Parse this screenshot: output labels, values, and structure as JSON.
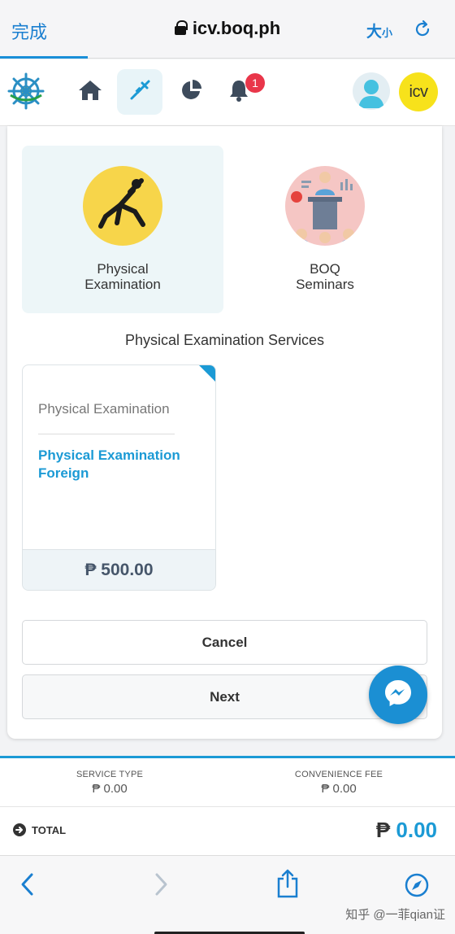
{
  "browser": {
    "done_label": "完成",
    "url": "icv.boq.ph",
    "text_size_big": "大",
    "text_size_small": "小"
  },
  "header": {
    "notification_count": "1",
    "brand_text": "icv"
  },
  "services": [
    {
      "label_line1": "Physical",
      "label_line2": "Examination",
      "selected": true
    },
    {
      "label_line1": "BOQ",
      "label_line2": "Seminars",
      "selected": false
    }
  ],
  "section_title": "Physical Examination Services",
  "package": {
    "name": "Physical Examination",
    "option_line1": "Physical Examination",
    "option_line2": "Foreign",
    "price": "₱ 500.00"
  },
  "buttons": {
    "cancel": "Cancel",
    "next": "Next"
  },
  "summary": {
    "service_type_label": "SERVICE TYPE",
    "service_type_value": "₱ 0.00",
    "convenience_fee_label": "CONVENIENCE FEE",
    "convenience_fee_value": "₱ 0.00",
    "total_label": "TOTAL",
    "total_currency": "₱",
    "total_amount": "0.00"
  },
  "watermark": "知乎 @一菲qian证",
  "colors": {
    "accent": "#1b9ad5",
    "safari_blue": "#1a7fd0",
    "badge_red": "#e9364a",
    "brand_yellow": "#f7e21b",
    "selected_tile": "#edf6f8"
  },
  "icons": [
    "lock-icon",
    "reload-icon",
    "home-icon",
    "syringe-icon",
    "pie-chart-icon",
    "bell-icon",
    "user-avatar-icon",
    "messenger-icon",
    "back-icon",
    "forward-icon",
    "share-icon",
    "compass-icon"
  ]
}
